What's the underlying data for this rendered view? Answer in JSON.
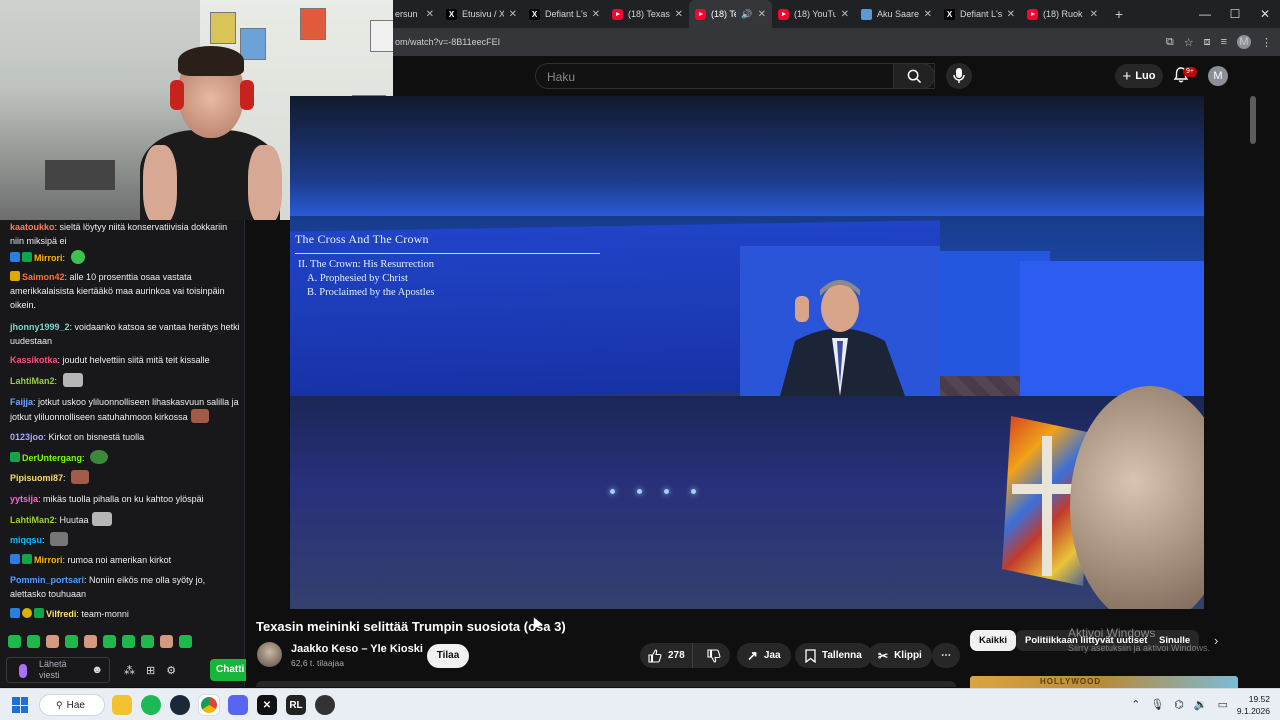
{
  "browser": {
    "tabs": [
      {
        "title": "ersun",
        "favicon": "partial",
        "active": false
      },
      {
        "title": "Etusivu / X",
        "favicon": "x-icon",
        "active": false
      },
      {
        "title": "Defiant L's",
        "favicon": "x-icon",
        "active": false
      },
      {
        "title": "(18) Texas",
        "favicon": "youtube-icon",
        "active": false
      },
      {
        "title": "(18) Te",
        "favicon": "youtube-icon",
        "active": true,
        "audio": true
      },
      {
        "title": "(18) YouTu",
        "favicon": "youtube-icon",
        "active": false
      },
      {
        "title": "Aku Saare",
        "favicon": "aku-icon",
        "active": false
      },
      {
        "title": "Defiant L's",
        "favicon": "x-icon",
        "active": false
      },
      {
        "title": "(18) Ruok",
        "favicon": "youtube-icon",
        "active": false
      }
    ],
    "new_tab": "+",
    "window_controls": {
      "minimize": "—",
      "maximize": "☐",
      "close": "✕"
    },
    "url": "om/watch?v=-8B11eecFEI",
    "profile_initial": "M"
  },
  "youtube": {
    "search_placeholder": "Haku",
    "create_label": "Luo",
    "notification_badge": "9+",
    "avatar_initial": "M",
    "video": {
      "slide_heading": "The Cross And The Crown",
      "slide_lines": [
        "II. The Crown: His Resurrection",
        "A. Prophesied by Christ",
        "B. Proclaimed by the Apostles"
      ]
    },
    "title": "Texasin meininki selittää Trumpin suosiota (osa 3)",
    "channel_name": "Jaakko Keso – Yle Kioski",
    "subscribers": "62,6 t. tilaajaa",
    "subscribe_label": "Tilaa",
    "like_count": "278",
    "share_label": "Jaa",
    "save_label": "Tallenna",
    "clip_label": "Klippi",
    "more_label": "⋯",
    "chips": [
      "Kaikki",
      "Politiikkaan liittyvät uutiset",
      "Sinulle"
    ],
    "chip_next": "›",
    "thumb_text": "HOLLYWOOD"
  },
  "windows_watermark": {
    "line1": "Aktivoi Windows",
    "line2": "Siirry asetuksiin ja aktivoi Windows."
  },
  "chat": {
    "messages": [
      {
        "user": "kaatoukko",
        "color": "#ff7f50",
        "badges": [],
        "text": "sieltä löytyy niitä konservatiivisia dokkariin niin miksipä ei"
      },
      {
        "user": "Mirrori",
        "color": "#ffb000",
        "badges": [
          "blue",
          "green"
        ],
        "text": "",
        "emote": "frog"
      },
      {
        "user": "Saimon42",
        "color": "#ff6f3c",
        "badges": [
          "crown"
        ],
        "text": "alle 10 prosenttia osaa vastata amerikkalaisista kiertääkö maa aurinkoa vai toisinpäin oikein."
      },
      {
        "user": "jhonny1999_2",
        "color": "#7fd5c4",
        "badges": [],
        "text": "voidaanko katsoa se vantaa herätys hetki uudestaan"
      },
      {
        "user": "Kassikotka",
        "color": "#ff4f7b",
        "badges": [],
        "text": "joudut helvettiin siitä mitä teit kissalle"
      },
      {
        "user": "LahtiMan2",
        "color": "#9acd32",
        "badges": [],
        "text": "",
        "emote": "cat"
      },
      {
        "user": "Faijja",
        "color": "#6aa7ff",
        "badges": [],
        "text": "jotkut uskoo yliluonnolliseen lihaskasvuun salilla ja jotkut yliluonnolliseen satuhahmoon kirkossa",
        "emote": "face"
      },
      {
        "user": "0123joo",
        "color": "#a9a9ff",
        "badges": [],
        "text": "Kirkot on bisnestä tuolla"
      },
      {
        "user": "DerUntergang",
        "color": "#7cfc00",
        "badges": [
          "green"
        ],
        "text": "",
        "emote": "pepe"
      },
      {
        "user": "Pipisuomi87",
        "color": "#ffd966",
        "badges": [],
        "text": "",
        "emote": "face"
      },
      {
        "user": "yytsija",
        "color": "#ff66cc",
        "badges": [],
        "text": "mikäs tuolla pihalla on ku kahtoo ylöspäi"
      },
      {
        "user": "LahtiMan2",
        "color": "#9acd32",
        "badges": [],
        "text": "Huutaa",
        "emote": "cat"
      },
      {
        "user": "miqqsu",
        "color": "#00bfff",
        "badges": [],
        "text": "",
        "emote": "rock"
      },
      {
        "user": "Mirrori",
        "color": "#ffb000",
        "badges": [
          "blue",
          "green"
        ],
        "text": "rumoa noi amerikan kirkot"
      },
      {
        "user": "Pommin_portsari",
        "color": "#4f9dff",
        "badges": [],
        "text": "Noniin eikös me olla syöty jo, alettasko touhuaan"
      },
      {
        "user": "Vilfredi",
        "color": "#ffe066",
        "badges": [
          "blue",
          "yellow",
          "green"
        ],
        "text": "team-monni"
      }
    ],
    "input_placeholder": "Lähetä viesti",
    "chat_button": "Chatti"
  },
  "taskbar": {
    "search_label": "Hae",
    "time": "19.52",
    "date": "9.1.2026"
  },
  "colors": {
    "yt_bg": "#0f0f0f",
    "chat_bg": "#18181b",
    "twitch_green": "#18b53a",
    "yt_red": "#ff0033"
  }
}
